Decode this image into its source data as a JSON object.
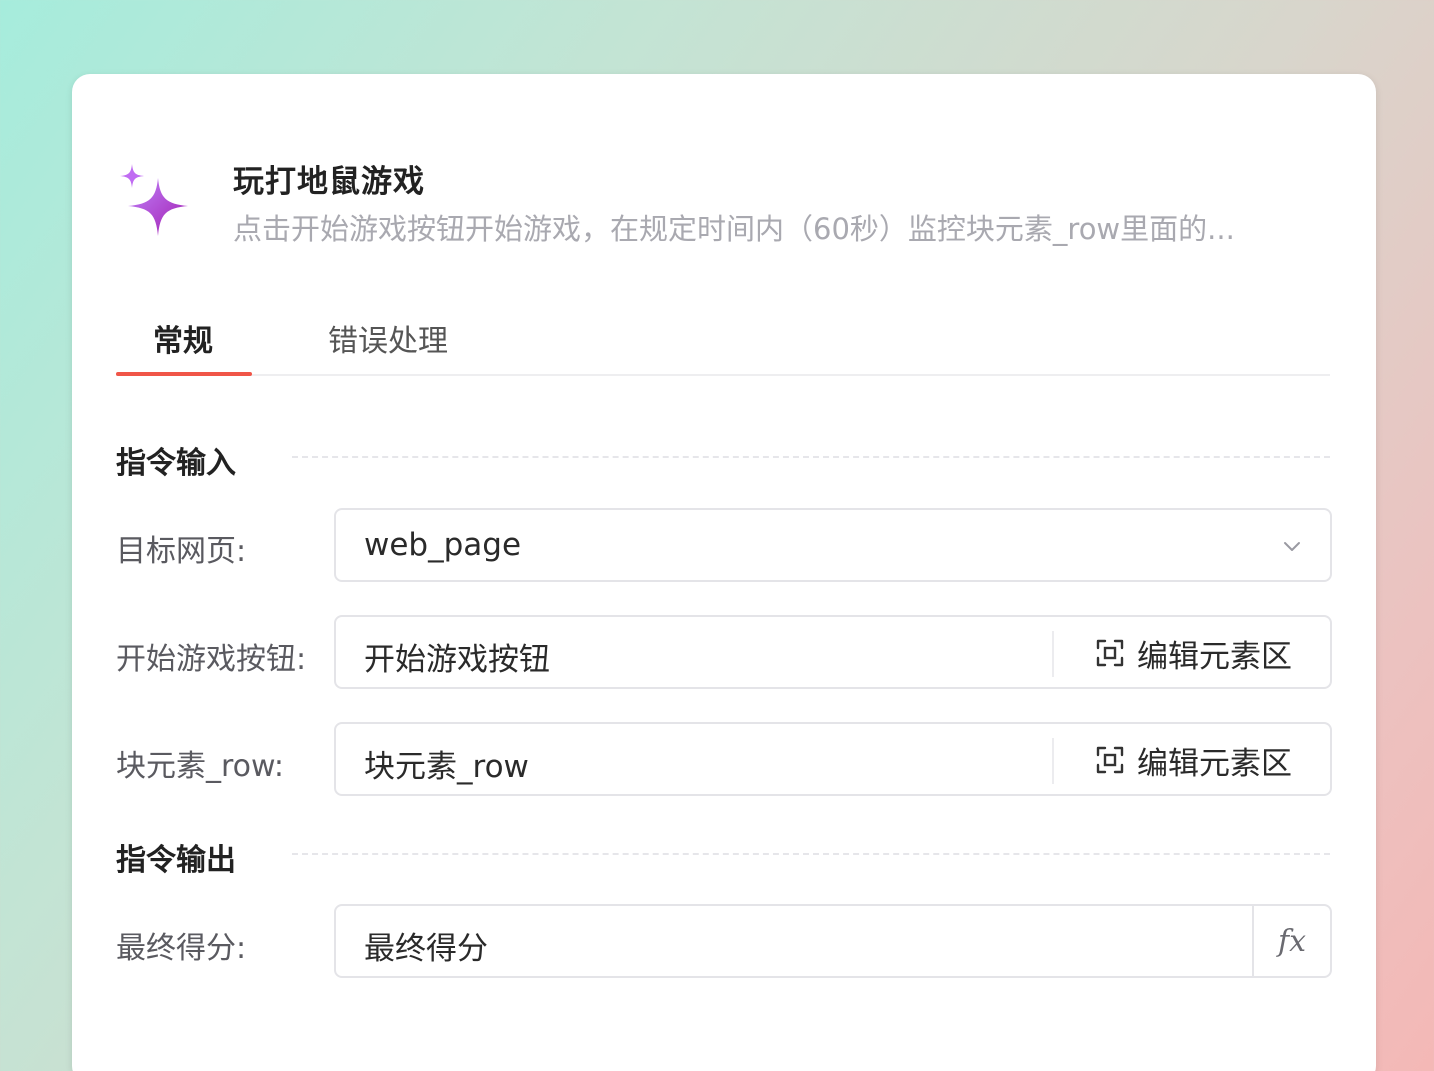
{
  "header": {
    "icon": "sparkle-icon",
    "title": "玩打地鼠游戏",
    "subtitle": "点击开始游戏按钮开始游戏，在规定时间内（60秒）监控块元素_row里面的..."
  },
  "tabs": [
    {
      "label": "常规",
      "active": true
    },
    {
      "label": "错误处理",
      "active": false
    }
  ],
  "sections": {
    "input_title": "指令输入",
    "output_title": "指令输出"
  },
  "fields": {
    "target_page": {
      "label": "目标网页:",
      "value": "web_page"
    },
    "start_button": {
      "label": "开始游戏按钮:",
      "value": "开始游戏按钮",
      "action": "编辑元素区"
    },
    "block_row": {
      "label": "块元素_row:",
      "value": "块元素_row",
      "action": "编辑元素区"
    },
    "final_score": {
      "label": "最终得分:",
      "value": "最终得分",
      "fx": "fx"
    }
  },
  "colors": {
    "accent_tab": "#f05548",
    "sparkle": "#a855f7"
  }
}
